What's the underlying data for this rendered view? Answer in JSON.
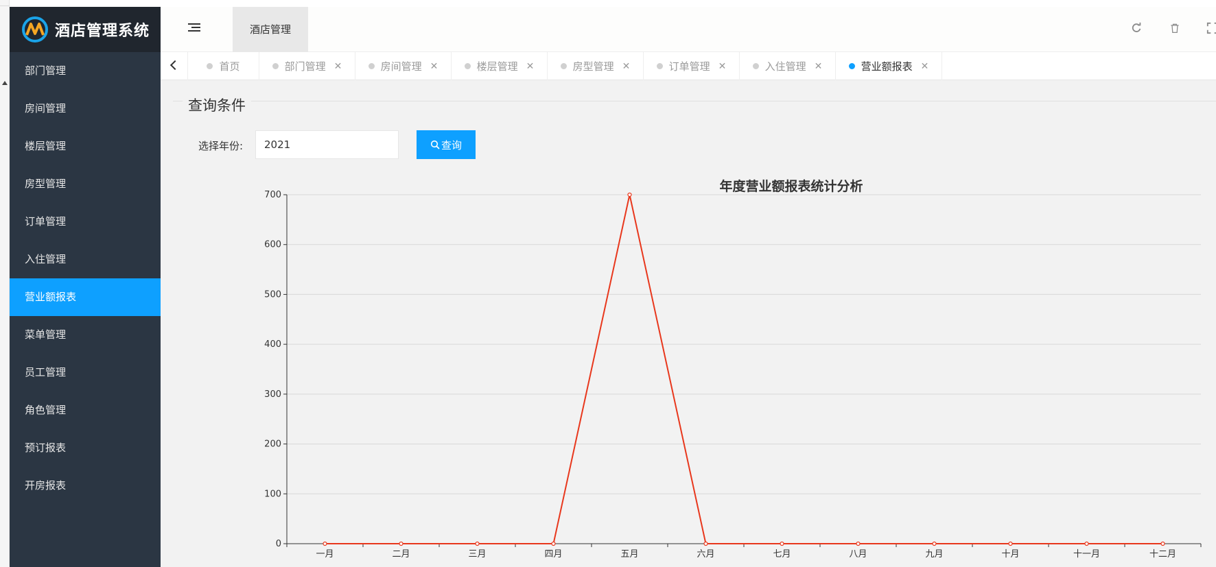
{
  "app": {
    "title": "酒店管理系统"
  },
  "colors": {
    "sidebar": "#2b3643",
    "accent": "#0ea0ff",
    "line": "#e8371c"
  },
  "sidebar": {
    "items": [
      {
        "label": "部门管理",
        "active": false
      },
      {
        "label": "房间管理",
        "active": false
      },
      {
        "label": "楼层管理",
        "active": false
      },
      {
        "label": "房型管理",
        "active": false
      },
      {
        "label": "订单管理",
        "active": false
      },
      {
        "label": "入住管理",
        "active": false
      },
      {
        "label": "营业额报表",
        "active": true
      },
      {
        "label": "菜单管理",
        "active": false
      },
      {
        "label": "员工管理",
        "active": false
      },
      {
        "label": "角色管理",
        "active": false
      },
      {
        "label": "预订报表",
        "active": false
      },
      {
        "label": "开房报表",
        "active": false
      }
    ]
  },
  "header": {
    "top_tab": "酒店管理",
    "icons": [
      "menu-icon",
      "refresh-icon",
      "trash-icon",
      "fullscreen-icon"
    ]
  },
  "tabs": [
    {
      "label": "首页",
      "closable": false,
      "active": false
    },
    {
      "label": "部门管理",
      "closable": true,
      "active": false
    },
    {
      "label": "房间管理",
      "closable": true,
      "active": false
    },
    {
      "label": "楼层管理",
      "closable": true,
      "active": false
    },
    {
      "label": "房型管理",
      "closable": true,
      "active": false
    },
    {
      "label": "订单管理",
      "closable": true,
      "active": false
    },
    {
      "label": "入住管理",
      "closable": true,
      "active": false
    },
    {
      "label": "营业额报表",
      "closable": true,
      "active": true
    }
  ],
  "query": {
    "legend": "查询条件",
    "year_label": "选择年份:",
    "year_value": "2021",
    "button_label": "查询"
  },
  "chart_data": {
    "type": "line",
    "title": "年度营业额报表统计分析",
    "categories": [
      "一月",
      "二月",
      "三月",
      "四月",
      "五月",
      "六月",
      "七月",
      "八月",
      "九月",
      "十月",
      "十一月",
      "十二月"
    ],
    "series": [
      {
        "values": [
          0,
          0,
          0,
          0,
          700,
          0,
          0,
          0,
          0,
          0,
          0,
          0
        ]
      }
    ],
    "ylim": [
      0,
      700
    ],
    "yticks": [
      0,
      100,
      200,
      300,
      400,
      500,
      600,
      700
    ],
    "grid": true,
    "xlabel": "",
    "ylabel": ""
  }
}
